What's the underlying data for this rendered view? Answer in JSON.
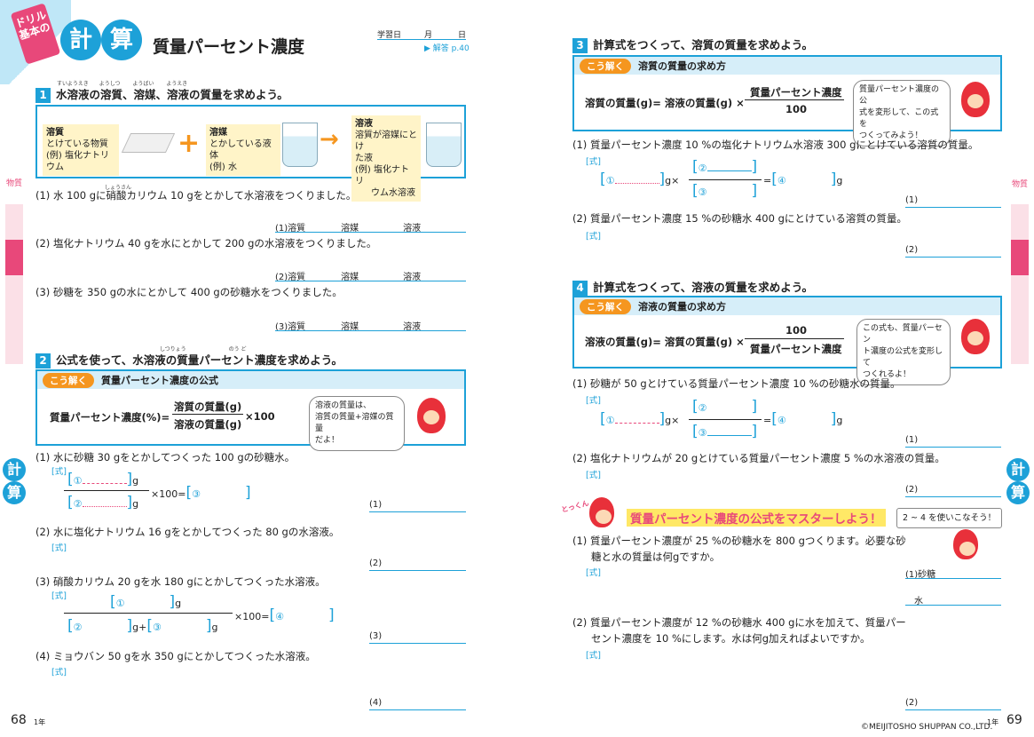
{
  "left": {
    "tag": "ドリル\n基本の",
    "title_c1": "計",
    "title_c2": "算",
    "title": "質量パーセント濃度",
    "date_label": "学習日",
    "month": "月",
    "day": "日",
    "answer_ref": "▶ 解答 p.40",
    "q1": {
      "num": "1",
      "head": "水溶液の溶質、溶媒、溶液の質量を求めよう。",
      "ruby1": "すいようえき",
      "ruby2": "ようしつ",
      "ruby3": "ようばい",
      "ruby4": "ようえき",
      "solute_t": "溶質",
      "solute_d1": "とけている物質",
      "solute_d2": "(例) 塩化ナトリウム",
      "solvent_t": "溶媒",
      "solvent_d1": "とかしている液体",
      "solvent_d2": "(例) 水",
      "sol_t": "溶液",
      "sol_d1": "溶質が溶媒にとけ",
      "sol_d2": "た液",
      "sol_d3": "(例) 塩化ナトリ",
      "sol_d4": "ウム水溶液",
      "plus": "+",
      "arrow": "→",
      "p1": "(1)  水 100 gに硝酸カリウム 10 gをとかして水溶液をつくりました。",
      "p1ruby": "しょうさん",
      "p2": "(2)  塩化ナトリウム 40 gを水にとかして 200 gの水溶液をつくりました。",
      "p3": "(3)  砂糖を 350 gの水にとかして 400 gの砂糖水をつくりました。",
      "a1": "(1)",
      "a2": "(2)",
      "a3": "(3)",
      "l_solute": "溶質",
      "l_solvent": "溶媒",
      "l_sol": "溶液"
    },
    "q2": {
      "num": "2",
      "head": "公式を使って、水溶液の質量パーセント濃度を求めよう。",
      "ruby1": "しつりょう",
      "ruby2": "のう ど",
      "kai": "こう解く",
      "box_title": "質量パーセント濃度の公式",
      "f_lhs": "質量パーセント濃度(%)=",
      "f_num": "溶質の質量(g)",
      "f_den": "溶液の質量(g)",
      "f_x": "×100",
      "bubble": "溶液の質量は、\n溶質の質量+溶媒の質量\nだよ！",
      "p1": "(1)  水に砂糖 30 gをとかしてつくった 100 gの砂糖水。",
      "p2": "(2)  水に塩化ナトリウム 16 gをとかしてつくった 80 gの水溶液。",
      "p3": "(3)  硝酸カリウム 20 gを水 180 gにとかしてつくった水溶液。",
      "p4": "(4)  ミョウバン 50 gを水 350 gにとかしてつくった水溶液。",
      "shiki": "[式]",
      "c1": "①",
      "c2": "②",
      "c3": "③",
      "c4": "④",
      "g": "g",
      "eq1": "×100=",
      "gplus": "g+",
      "eq2": "×100=",
      "a1": "(1)",
      "a2": "(2)",
      "a3": "(3)",
      "a4": "(4)"
    },
    "page_num": "68",
    "grade": "1年",
    "side_sub": "物質",
    "side_calc1": "計",
    "side_calc2": "算"
  },
  "right": {
    "q3": {
      "num": "3",
      "head": "計算式をつくって、溶質の質量を求めよう。",
      "kai": "こう解く",
      "box_title": "溶質の質量の求め方",
      "f_lhs": "溶質の質量(g)= 溶液の質量(g) ×",
      "f_num": "質量パーセント濃度",
      "f_den": "100",
      "bubble": "質量パーセント濃度の公\n式を変形して、この式を\nつくってみよう！",
      "p1": "(1)  質量パーセント濃度 10 %の塩化ナトリウム水溶液 300 gにとけている溶質の質量。",
      "p2": "(2)  質量パーセント濃度 15 %の砂糖水 400 gにとけている溶質の質量。",
      "shiki": "[式]",
      "c1": "①",
      "c2": "②",
      "c3": "③",
      "c4": "④",
      "gx": "g×",
      "eq": "=",
      "g": "g",
      "a1": "(1)",
      "a2": "(2)"
    },
    "q4": {
      "num": "4",
      "head": "計算式をつくって、溶液の質量を求めよう。",
      "kai": "こう解く",
      "box_title": "溶液の質量の求め方",
      "f_lhs": "溶液の質量(g)= 溶質の質量(g) ×",
      "f_num": "100",
      "f_den": "質量パーセント濃度",
      "bubble": "この式も、質量パーセン\nト濃度の公式を変形して\nつくれるよ！",
      "p1": "(1)  砂糖が 50 gとけている質量パーセント濃度 10 %の砂糖水の質量。",
      "p2": "(2)  塩化ナトリウムが 20 gとけている質量パーセント濃度 5 %の水溶液の質量。",
      "shiki": "[式]",
      "c1": "①",
      "c2": "②",
      "c3": "③",
      "c4": "④",
      "gx": "g×",
      "eq": "=",
      "g": "g",
      "a1": "(1)",
      "a2": "(2)"
    },
    "toku": {
      "label": "とっくん",
      "head": "質量パーセント濃度の公式をマスターしよう！",
      "tip": "2 ~ 4 を使いこなそう！",
      "p1": "(1)  質量パーセント濃度が 25 %の砂糖水を 800 gつくります。必要な砂",
      "p1b": "糖と水の質量は何gですか。",
      "p2": "(2)  質量パーセント濃度が 12 %の砂糖水 400 gに水を加えて、質量パー",
      "p2b": "セント濃度を 10 %にします。水は何g加えればよいですか。",
      "shiki": "[式]",
      "a1": "(1)砂糖",
      "a1b": "水",
      "a2": "(2)"
    },
    "page_num": "69",
    "grade": "1年",
    "copyright": "©MEIJITOSHO SHUPPAN CO.,LTD.",
    "side_sub": "物質",
    "side_calc1": "計",
    "side_calc2": "算"
  }
}
